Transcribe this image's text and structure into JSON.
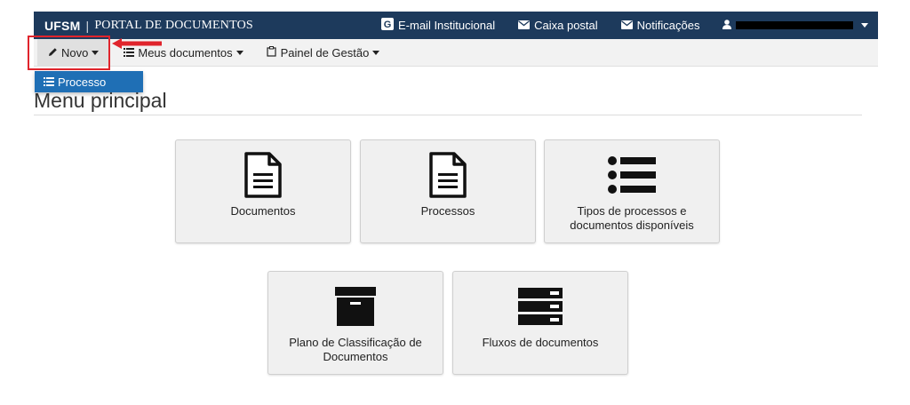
{
  "header": {
    "brand_short": "UFSM",
    "brand_separator": "|",
    "brand_name": "PORTAL DE DOCUMENTOS",
    "links": [
      {
        "label": "E-mail Institucional",
        "icon": "google-icon"
      },
      {
        "label": "Caixa postal",
        "icon": "envelope-icon"
      },
      {
        "label": "Notificações",
        "icon": "envelope-icon"
      }
    ],
    "user_icon": "user-icon"
  },
  "menubar": {
    "novo_label": "Novo",
    "meus_documentos_label": "Meus documentos",
    "painel_label": "Painel de Gestão"
  },
  "dropdown": {
    "processo_label": "Processo"
  },
  "main": {
    "title": "Menu principal",
    "tiles": [
      {
        "label": "Documentos",
        "icon": "document-icon"
      },
      {
        "label": "Processos",
        "icon": "document-icon"
      },
      {
        "label": "Tipos de processos e documentos disponíveis",
        "icon": "list-icon"
      },
      {
        "label": "Plano de Classificação de Documentos",
        "icon": "archive-box-icon"
      },
      {
        "label": "Fluxos de documentos",
        "icon": "server-icon"
      }
    ]
  },
  "colors": {
    "header_bg": "#1d3a5c",
    "dropdown_bg": "#1f6fb5",
    "highlight": "#e0242c"
  }
}
